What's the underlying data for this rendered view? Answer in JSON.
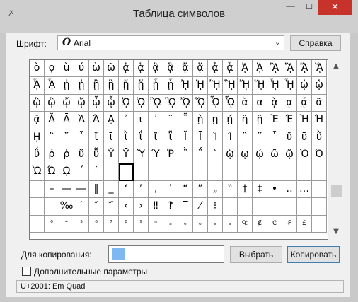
{
  "window": {
    "title": "Таблица символов",
    "app_icon": "ꭗ",
    "minimize_glyph": "—",
    "maximize_glyph": "☐",
    "close_glyph": "✕"
  },
  "font": {
    "label": "Шрифт:",
    "icon_glyph": "O",
    "value": "Arial",
    "arrow": "⌄"
  },
  "help_button": "Справка",
  "grid": {
    "rows": [
      [
        "ò",
        "ọ",
        "ù",
        "ύ",
        "ὼ",
        "ῶ",
        "ᾀ",
        "ᾁ",
        "ᾂ",
        "ᾃ",
        "ᾄ",
        "ᾅ",
        "ᾆ",
        "ᾇ",
        "ᾈ",
        "ᾉ",
        "ᾊ",
        "ᾋ",
        "ᾌ",
        "ᾍ"
      ],
      [
        "ᾎ",
        "ᾏ",
        "ᾐ",
        "ᾑ",
        "ᾒ",
        "ᾓ",
        "ᾔ",
        "ᾕ",
        "ᾖ",
        "ᾗ",
        "ᾘ",
        "ᾙ",
        "ᾚ",
        "ᾛ",
        "ᾜ",
        "ᾝ",
        "ᾞ",
        "ᾟ",
        "ᾠ",
        "ᾡ"
      ],
      [
        "ᾢ",
        "ᾣ",
        "ᾤ",
        "ᾥ",
        "ᾦ",
        "ᾧ",
        "ᾨ",
        "ᾩ",
        "ᾪ",
        "ᾫ",
        "ᾬ",
        "ᾭ",
        "ᾮ",
        "ᾯ",
        "ᾰ",
        "ᾱ",
        "ᾲ",
        "ᾳ",
        "ᾴ",
        "ᾶ"
      ],
      [
        "ᾷ",
        "Ᾰ",
        "Ᾱ",
        "Ὰ",
        "Ά",
        "ᾼ",
        "᾽",
        "ι",
        "᾿",
        "῀",
        "῁",
        "ῂ",
        "ῃ",
        "ῄ",
        "ῆ",
        "ῇ",
        "Ὲ",
        "Έ",
        "Ὴ",
        "Ή"
      ],
      [
        "ῌ",
        "῍",
        "῎",
        "῏",
        "ῐ",
        "ῑ",
        "ῒ",
        "ΐ",
        "ῖ",
        "ῗ",
        "Ῐ",
        "Ῑ",
        "Ὶ",
        "Ί",
        "῝",
        "῞",
        "῟",
        "ῠ",
        "ῡ",
        "ῢ"
      ],
      [
        "ΰ",
        "ῤ",
        "ῥ",
        "ῦ",
        "ῧ",
        "Ῠ",
        "Ῡ",
        "Ὺ",
        "Ύ",
        "Ῥ",
        "῭",
        "΅",
        "`",
        "ῲ",
        "ῳ",
        "ῴ",
        "ῶ",
        "ῷ",
        "Ὸ",
        "Ό"
      ],
      [
        "Ὼ",
        "Ώ",
        "ῼ",
        "´",
        "῾",
        "",
        "",
        "",
        "",
        "",
        "",
        "",
        "",
        "",
        "",
        "",
        "",
        "",
        "",
        ""
      ],
      [
        "",
        "–",
        "—",
        "―",
        "‖",
        "‗",
        "‘",
        "’",
        "‚",
        "‛",
        "“",
        "”",
        "„",
        "‟",
        "†",
        "‡",
        "•",
        "‥",
        "…",
        ""
      ],
      [
        "",
        "",
        "‰",
        "′",
        "″",
        "‴",
        "‹",
        "›",
        "‼",
        "‽",
        "‾",
        "⁄",
        "⁝",
        "",
        "",
        "",
        "",
        "",
        "",
        ""
      ],
      [
        "",
        "⁰",
        "⁴",
        "⁵",
        "⁶",
        "⁷",
        "⁸",
        "⁹",
        "ⁿ",
        "ₐ",
        "ₑ",
        "ₒ",
        "ₓ",
        "ₔ",
        "₠",
        "₡",
        "₢",
        "₣",
        "₤",
        ""
      ]
    ]
  },
  "scroll": {
    "up": "▲",
    "down": "▼"
  },
  "copy": {
    "label": "Для копирования:",
    "value": " ",
    "select_button": "Выбрать",
    "copy_button": "Копировать"
  },
  "advanced": {
    "label": "Дополнительные параметры",
    "checked": false
  },
  "status": "U+2001: Em Quad"
}
